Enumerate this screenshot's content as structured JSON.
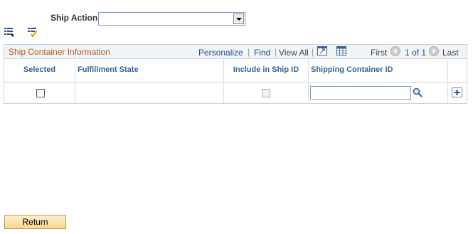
{
  "ship_action": {
    "label": "Ship Action",
    "selected_value": ""
  },
  "toolbar": {
    "icons": [
      "select-all-icon",
      "spell-check-icon"
    ]
  },
  "grid": {
    "title": "Ship Container Information",
    "nav": {
      "personalize": "Personalize",
      "sep1": "|",
      "find": "Find",
      "sep2": "|",
      "view_all": "View All",
      "sep3": "|",
      "first": "First",
      "range": "1 of 1",
      "last": "Last"
    },
    "columns": {
      "selected": "Selected",
      "fulfillment_state": "Fulfillment State",
      "include_in_ship_id": "Include in Ship ID",
      "shipping_container_id": "Shipping Container ID"
    },
    "rows": [
      {
        "selected": false,
        "fulfillment_state": "",
        "include_in_ship_id": false,
        "shipping_container_id": ""
      }
    ]
  },
  "buttons": {
    "return_label": "Return"
  },
  "colors": {
    "grid_title": "#b2591a",
    "column_header": "#336699",
    "link": "#20508b",
    "grid_border": "#c9d3dc"
  }
}
